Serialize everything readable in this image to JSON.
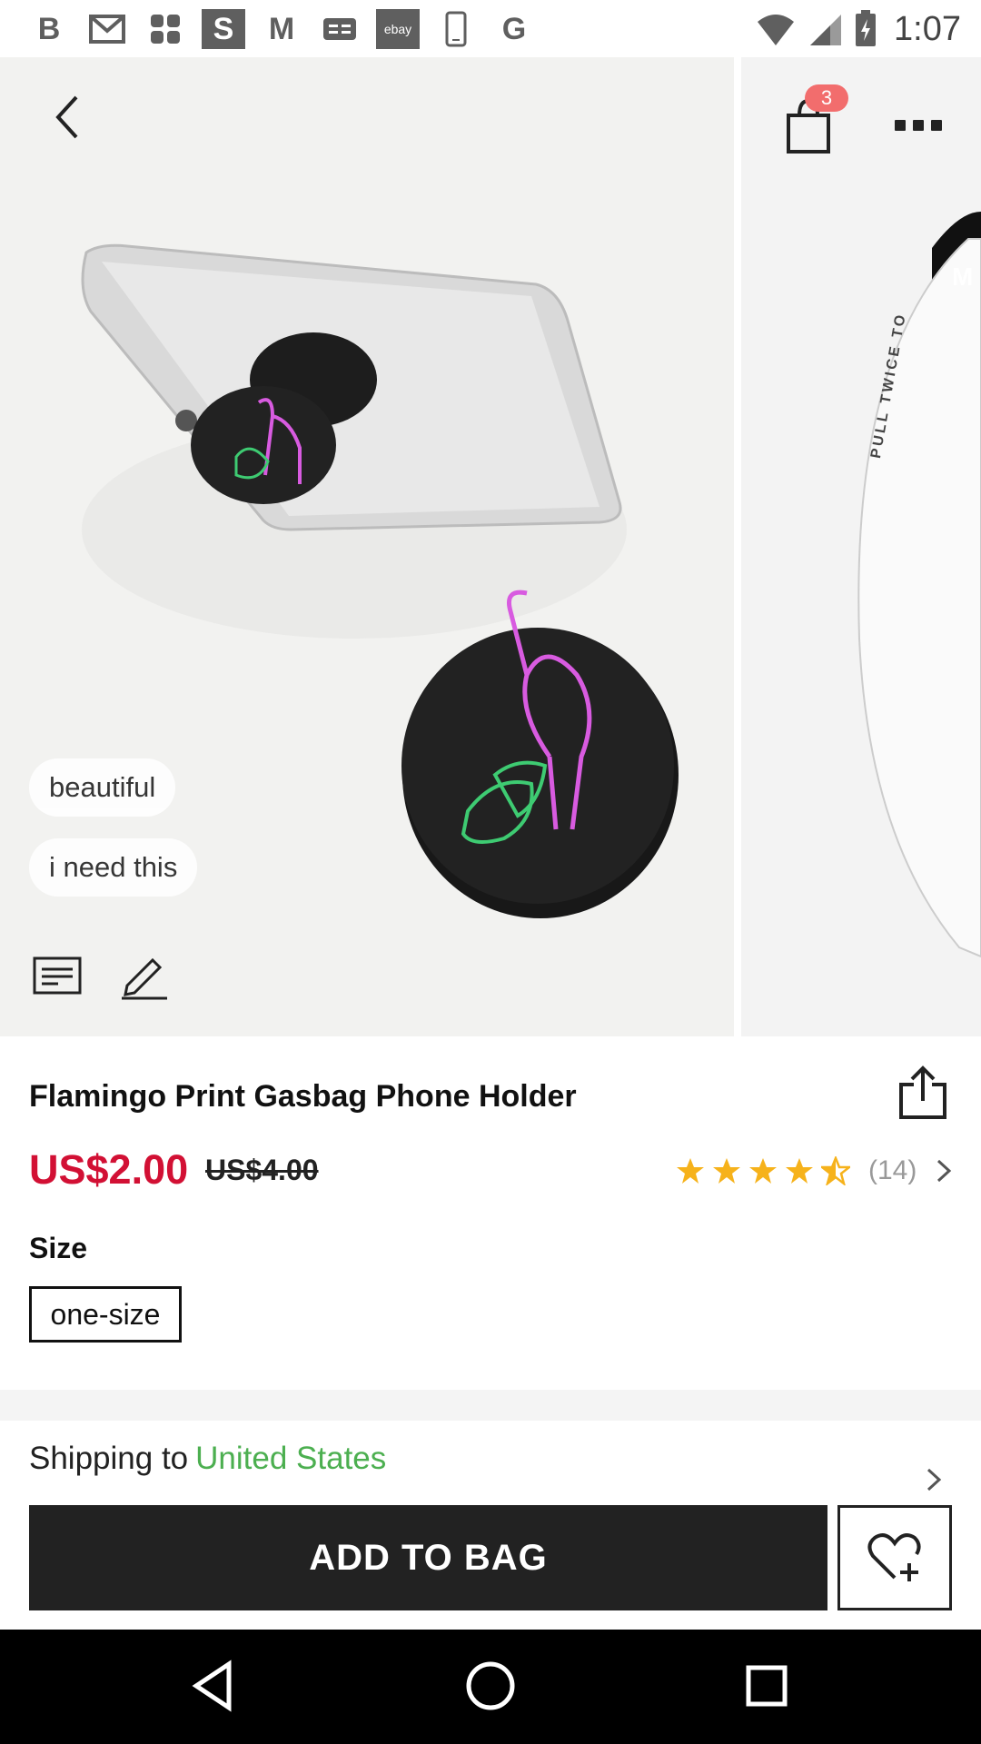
{
  "status_bar": {
    "time": "1:07",
    "notification_icons": [
      "b-icon",
      "gmail-icon",
      "pinwheel-icon",
      "s-icon",
      "m-icon",
      "ge-icon",
      "ebay-icon",
      "phone-icon",
      "google-icon"
    ],
    "letters": {
      "b": "B",
      "s": "S",
      "m": "M",
      "ebay": "ebay",
      "g": "G"
    }
  },
  "header": {
    "cart_count": "3"
  },
  "gallery": {
    "tags": [
      "beautiful",
      "i need this"
    ],
    "next_slide_text": "PULL TWICE TO",
    "next_slide_badge": "M"
  },
  "product": {
    "title": "Flamingo Print Gasbag Phone Holder",
    "price": "US$2.00",
    "original_price": "US$4.00",
    "rating": 4.5,
    "review_count": "(14)",
    "size_label": "Size",
    "size_options": [
      "one-size"
    ],
    "selected_size": "one-size"
  },
  "shipping": {
    "label": "Shipping to",
    "country": "United States"
  },
  "actions": {
    "add_to_bag": "ADD TO BAG"
  },
  "colors": {
    "price_red": "#d21034",
    "badge_red": "#f26d6d",
    "star_gold": "#f6b21b",
    "shipping_green": "#4caf50",
    "button_dark": "#222222"
  }
}
